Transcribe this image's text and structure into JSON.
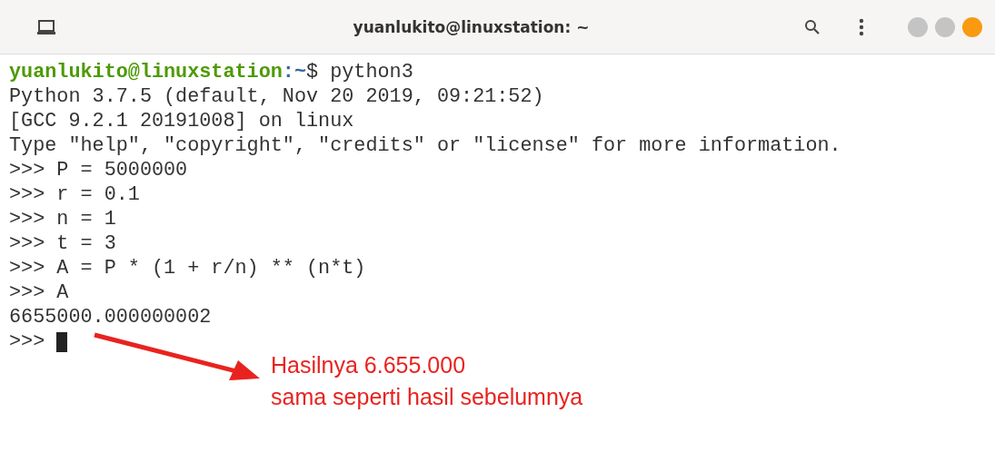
{
  "window": {
    "title": "yuanlukito@linuxstation: ~"
  },
  "terminal": {
    "prompt_user": "yuanlukito@linuxstation",
    "prompt_path": ":~",
    "prompt_rest": "$ python3",
    "lines": [
      "Python 3.7.5 (default, Nov 20 2019, 09:21:52)",
      "[GCC 9.2.1 20191008] on linux",
      "Type \"help\", \"copyright\", \"credits\" or \"license\" for more information.",
      ">>> P = 5000000",
      ">>> r = 0.1",
      ">>> n = 1",
      ">>> t = 3",
      ">>> A = P * (1 + r/n) ** (n*t)",
      ">>> A",
      "6655000.000000002"
    ],
    "final_prompt": ">>>"
  },
  "annotation": {
    "lines": [
      "Hasilnya 6.655.000",
      "sama seperti hasil sebelumnya"
    ]
  }
}
